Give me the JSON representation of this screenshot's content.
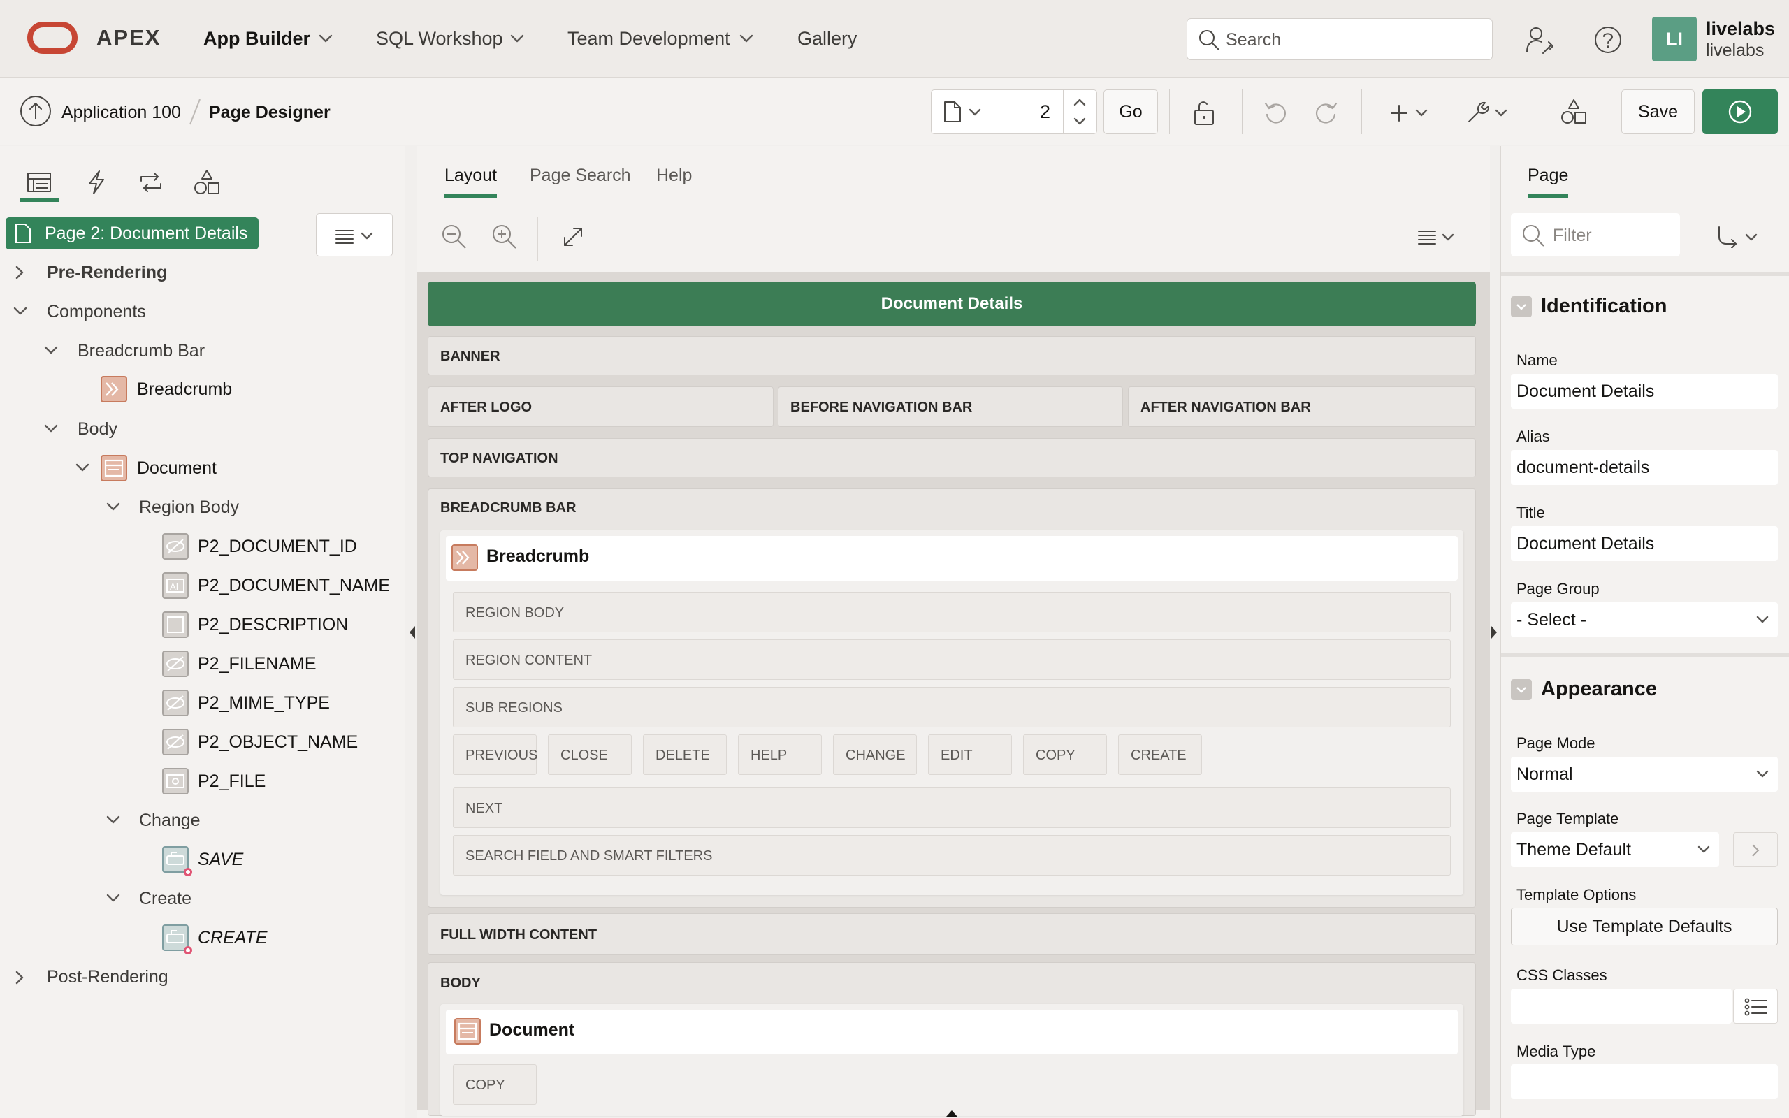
{
  "topnav": {
    "brand": "APEX",
    "items": [
      {
        "label": "App Builder",
        "bold": true
      },
      {
        "label": "SQL Workshop"
      },
      {
        "label": "Team Development"
      },
      {
        "label": "Gallery"
      }
    ],
    "search_placeholder": "Search",
    "user": {
      "initials": "LI",
      "name": "livelabs",
      "workspace": "livelabs"
    }
  },
  "toolbar": {
    "breadcrumb": {
      "app": "Application 100",
      "page": "Page Designer"
    },
    "page_number": "2",
    "go_label": "Go",
    "save_label": "Save"
  },
  "left": {
    "page_badge": "Page 2: Document Details",
    "tree": {
      "pre_rendering": "Pre-Rendering",
      "components": "Components",
      "breadcrumb_bar": "Breadcrumb Bar",
      "breadcrumb": "Breadcrumb",
      "body": "Body",
      "document": "Document",
      "region_body": "Region Body",
      "items": [
        "P2_DOCUMENT_ID",
        "P2_DOCUMENT_NAME",
        "P2_DESCRIPTION",
        "P2_FILENAME",
        "P2_MIME_TYPE",
        "P2_OBJECT_NAME",
        "P2_FILE"
      ],
      "change": "Change",
      "save": "SAVE",
      "create_group": "Create",
      "create": "CREATE",
      "post_rendering": "Post-Rendering"
    }
  },
  "center": {
    "tabs": [
      "Layout",
      "Page Search",
      "Help"
    ],
    "page_title": "Document Details",
    "slots": {
      "banner": "BANNER",
      "after_logo": "AFTER LOGO",
      "before_nav": "BEFORE NAVIGATION BAR",
      "after_nav": "AFTER NAVIGATION BAR",
      "top_nav": "TOP NAVIGATION",
      "breadcrumb_bar": "BREADCRUMB BAR",
      "full_width": "FULL WIDTH CONTENT",
      "body": "BODY"
    },
    "breadcrumb_region": {
      "title": "Breadcrumb",
      "region_body": "REGION BODY",
      "region_content": "REGION CONTENT",
      "sub_regions": "SUB REGIONS",
      "buttons": [
        "PREVIOUS",
        "CLOSE",
        "DELETE",
        "HELP",
        "CHANGE",
        "EDIT",
        "COPY",
        "CREATE"
      ],
      "next": "NEXT",
      "search_field": "SEARCH FIELD AND SMART FILTERS"
    },
    "document_region": {
      "title": "Document",
      "copy": "COPY"
    }
  },
  "right": {
    "tab": "Page",
    "filter_placeholder": "Filter",
    "identification": {
      "title": "Identification",
      "name_label": "Name",
      "name_value": "Document Details",
      "alias_label": "Alias",
      "alias_value": "document-details",
      "title_label": "Title",
      "title_value": "Document Details",
      "group_label": "Page Group",
      "group_value": "- Select -"
    },
    "appearance": {
      "title": "Appearance",
      "mode_label": "Page Mode",
      "mode_value": "Normal",
      "template_label": "Page Template",
      "template_value": "Theme Default",
      "options_label": "Template Options",
      "options_button": "Use Template Defaults",
      "css_label": "CSS Classes",
      "css_value": "",
      "media_label": "Media Type",
      "media_value": ""
    }
  },
  "colors": {
    "accent": "#33845a",
    "header_bar": "#3c7d55",
    "oracle_red": "#c74634"
  }
}
